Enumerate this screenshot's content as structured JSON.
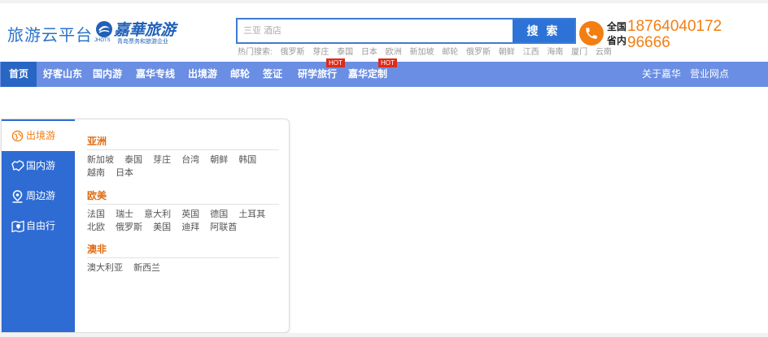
{
  "header": {
    "platform_title": "旅游云平台",
    "logo": {
      "script": "嘉華旅游",
      "tagline": "青岛票务和旅游企业",
      "sub": "JHOTS"
    },
    "search": {
      "placeholder": "三亚 酒店",
      "button_label": "搜 索"
    },
    "hot_search": {
      "label": "热门搜索:",
      "items": [
        "俄罗斯",
        "芽庄",
        "泰国",
        "日本",
        "欧洲",
        "新加坡",
        "邮轮",
        "俄罗斯",
        "朝鲜",
        "江西",
        "海南",
        "厦门",
        "云南"
      ]
    },
    "contact": {
      "label_national": "全国",
      "label_province": "省内",
      "number_national": "18764040172",
      "number_province": "96666",
      "icon": "phone-icon",
      "accent_color": "#f37e12"
    }
  },
  "nav": {
    "items": [
      "首页",
      "好客山东",
      "国内游",
      "嘉华专线",
      "出境游",
      "邮轮",
      "签证",
      "研学旅行",
      "嘉华定制"
    ],
    "hot_badge": "HOT",
    "right_items": [
      "关于嘉华",
      "营业网点"
    ],
    "active": "首页"
  },
  "dest_panel": {
    "categories": [
      {
        "label": "出境游",
        "icon": "globe-icon"
      },
      {
        "label": "国内游",
        "icon": "map-outline-icon"
      },
      {
        "label": "周边游",
        "icon": "location-pin-icon"
      },
      {
        "label": "自由行",
        "icon": "map-pin-icon"
      }
    ],
    "active_category": "出境游",
    "regions": [
      {
        "title": "亚洲",
        "links": [
          "新加坡",
          "泰国",
          "芽庄",
          "台湾",
          "朝鲜",
          "韩国",
          "越南",
          "日本"
        ]
      },
      {
        "title": "欧美",
        "links": [
          "法国",
          "瑞士",
          "意大利",
          "英国",
          "德国",
          "土耳其",
          "北欧",
          "俄罗斯",
          "美国",
          "迪拜",
          "阿联酋"
        ]
      },
      {
        "title": "澳非",
        "links": [
          "澳大利亚",
          "新西兰"
        ]
      }
    ]
  },
  "colors": {
    "nav_bg": "#6a8ee3",
    "nav_active": "#2866c4",
    "brand_blue": "#2b73c9",
    "orange": "#f37e12",
    "hot_red": "#e02a1a"
  }
}
